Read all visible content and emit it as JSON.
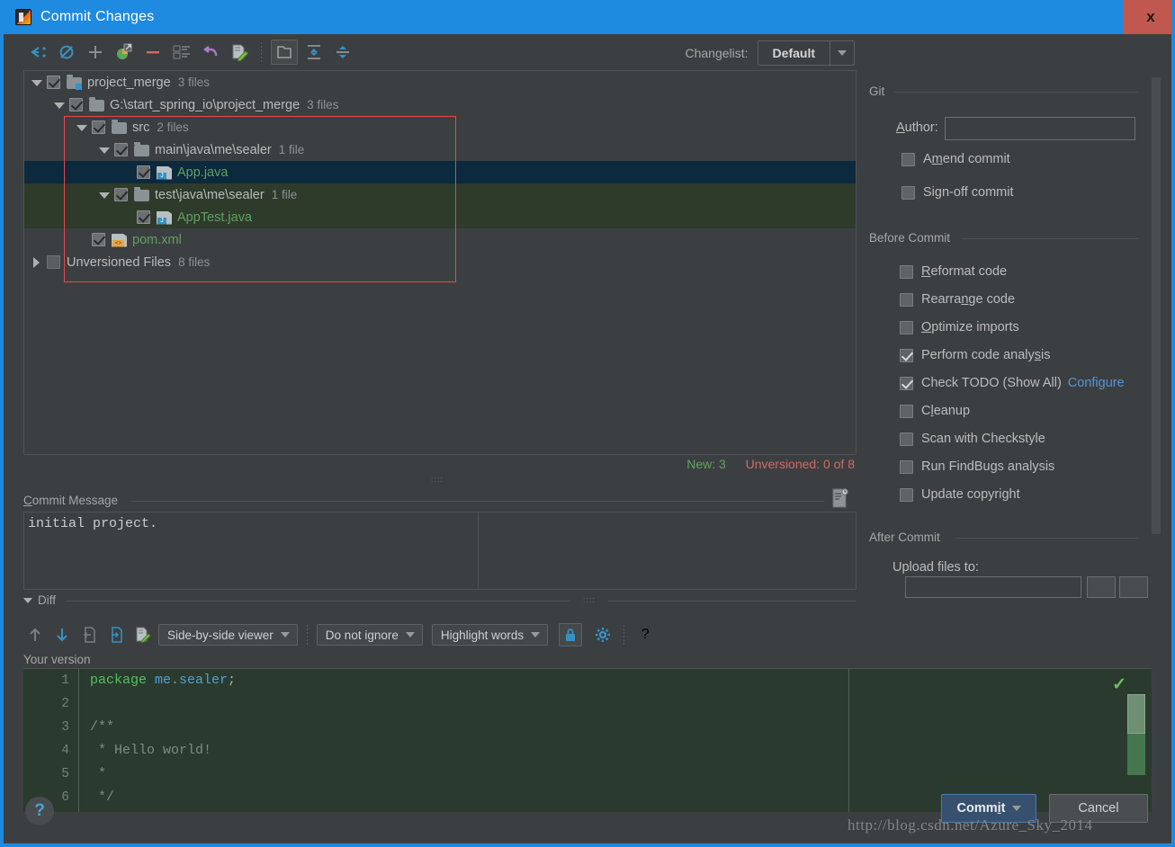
{
  "window": {
    "title": "Commit Changes",
    "app_icon": "intellij-idea-icon",
    "close_label": "x"
  },
  "toolbar": {
    "icons": [
      {
        "name": "show-diff-icon",
        "glyph": "↙"
      },
      {
        "name": "revert-refresh-icon",
        "glyph": "Ø"
      },
      {
        "name": "add-icon",
        "glyph": "+"
      },
      {
        "name": "move-to-changelist-icon",
        "glyph": "❐"
      },
      {
        "name": "delete-icon",
        "glyph": "—"
      },
      {
        "name": "group-by-icon",
        "glyph": "≣"
      },
      {
        "name": "rollback-icon",
        "glyph": "↩"
      },
      {
        "name": "edit-source-icon",
        "glyph": "✎"
      },
      {
        "name": "group-by-directory-icon",
        "glyph": "▣"
      },
      {
        "name": "expand-all-icon",
        "glyph": "⇕"
      },
      {
        "name": "collapse-all-icon",
        "glyph": "⇵"
      }
    ],
    "changelist_label": "Changelist:",
    "changelist_label_mnemonic": "t",
    "changelist_value": "Default"
  },
  "tree": {
    "rows": [
      {
        "indent": 0,
        "twisty": "open",
        "checkbox": "checked",
        "icon": "module-icon",
        "name": "project_merge",
        "count": "3 files",
        "state": "normal",
        "name_class": "nm"
      },
      {
        "indent": 1,
        "twisty": "open",
        "checkbox": "checked",
        "icon": "folder-icon",
        "name": "G:\\start_spring_io\\project_merge",
        "count": "3 files",
        "state": "normal",
        "name_class": "nm"
      },
      {
        "indent": 2,
        "twisty": "open",
        "checkbox": "checked",
        "icon": "folder-icon",
        "name": "src",
        "count": "2 files",
        "state": "normal",
        "name_class": "nm"
      },
      {
        "indent": 3,
        "twisty": "open",
        "checkbox": "checked",
        "icon": "folder-icon",
        "name": "main\\java\\me\\sealer",
        "count": "1 file",
        "state": "normal",
        "name_class": "nm"
      },
      {
        "indent": 4,
        "twisty": "none",
        "checkbox": "checked",
        "icon": "java-file-icon",
        "name": "App.java",
        "count": "",
        "state": "selected",
        "name_class": "nm file-new"
      },
      {
        "indent": 3,
        "twisty": "open",
        "checkbox": "checked",
        "icon": "folder-icon",
        "name": "test\\java\\me\\sealer",
        "count": "1 file",
        "state": "green",
        "name_class": "nm"
      },
      {
        "indent": 4,
        "twisty": "none",
        "checkbox": "checked",
        "icon": "java-file-icon",
        "name": "AppTest.java",
        "count": "",
        "state": "green",
        "name_class": "nm file-new"
      },
      {
        "indent": 2,
        "twisty": "none",
        "checkbox": "checked",
        "icon": "xml-file-icon",
        "name": "pom.xml",
        "count": "",
        "state": "normal",
        "name_class": "nm file-new"
      },
      {
        "indent": 0,
        "twisty": "closed",
        "checkbox": "empty",
        "icon": "none",
        "name": "Unversioned Files",
        "count": "8 files",
        "state": "normal",
        "name_class": "nm"
      }
    ],
    "status_new": "New: 3",
    "status_unversioned": "Unversioned: 0 of 8",
    "annotation": "red-highlight-box"
  },
  "commit_message": {
    "label": "Commit Message",
    "label_mnemonic": "C",
    "value": "initial project.",
    "history_icon": "commit-message-history-icon"
  },
  "diff": {
    "section_label": "Diff",
    "toolbar_icons": [
      {
        "name": "previous-difference-icon",
        "glyph": "↑"
      },
      {
        "name": "next-difference-icon",
        "glyph": "↓"
      },
      {
        "name": "revert-change-icon",
        "glyph": "⇤"
      },
      {
        "name": "apply-change-icon",
        "glyph": "⇥"
      },
      {
        "name": "edit-source-icon",
        "glyph": "✎"
      }
    ],
    "viewer_mode": "Side-by-side viewer",
    "ignore_mode": "Do not ignore",
    "highlight_mode": "Highlight words",
    "lock_icon": "read-only-lock-icon",
    "settings_icon": "gear-icon",
    "help_icon": "question-mark-icon",
    "your_version_label": "Your version",
    "line_numbers": [
      "1",
      "2",
      "3",
      "4",
      "5",
      "6"
    ],
    "code_lines": [
      {
        "segments": [
          {
            "t": "package ",
            "c": "kw"
          },
          {
            "t": "me.sealer",
            "c": "pk"
          },
          {
            "t": ";",
            "c": "pn"
          }
        ]
      },
      {
        "segments": [
          {
            "t": "",
            "c": ""
          }
        ]
      },
      {
        "segments": [
          {
            "t": "/**",
            "c": ""
          }
        ]
      },
      {
        "segments": [
          {
            "t": " * Hello world!",
            "c": ""
          }
        ]
      },
      {
        "segments": [
          {
            "t": " *",
            "c": ""
          }
        ]
      },
      {
        "segments": [
          {
            "t": " */",
            "c": ""
          }
        ]
      }
    ],
    "ok_check_icon": "no-problems-check-icon"
  },
  "git": {
    "section_label": "Git",
    "author_label": "Author:",
    "author_mnemonic": "A",
    "author_value": "",
    "options": [
      {
        "label": "Amend commit",
        "mnemonic": "m",
        "checked": false
      },
      {
        "label": "Sign-off commit",
        "mnemonic": "g",
        "checked": false
      }
    ]
  },
  "before_commit": {
    "section_label": "Before Commit",
    "options": [
      {
        "label": "Reformat code",
        "mnemonic": "R",
        "checked": false,
        "link": ""
      },
      {
        "label": "Rearrange code",
        "mnemonic": "n",
        "checked": false,
        "link": ""
      },
      {
        "label": "Optimize imports",
        "mnemonic": "O",
        "checked": false,
        "link": ""
      },
      {
        "label": "Perform code analysis",
        "mnemonic": "s",
        "checked": true,
        "link": ""
      },
      {
        "label": "Check TODO (Show All)",
        "mnemonic": "",
        "checked": true,
        "link": "Configure"
      },
      {
        "label": "Cleanup",
        "mnemonic": "l",
        "checked": false,
        "link": ""
      },
      {
        "label": "Scan with Checkstyle",
        "mnemonic": "",
        "checked": false,
        "link": ""
      },
      {
        "label": "Run FindBugs analysis",
        "mnemonic": "",
        "checked": false,
        "link": ""
      },
      {
        "label": "Update copyright",
        "mnemonic": "",
        "checked": false,
        "link": ""
      }
    ]
  },
  "after_commit": {
    "section_label": "After Commit",
    "upload_label": "Upload files to:",
    "upload_value": ""
  },
  "footer": {
    "help_label": "?",
    "commit_label": "Comm",
    "commit_label_mnemonic": "i",
    "commit_label_tail": "t",
    "cancel_label": "Cancel",
    "watermark": "http://blog.csdn.net/Azure_Sky_2014"
  },
  "colors": {
    "titlebar": "#1e8ae0",
    "close": "#c0584f",
    "selection": "#0d293e",
    "modified_green": "#2e3b2b",
    "new_file_text": "#60a060",
    "status_new": "#62a362",
    "status_unversioned": "#cf6b63",
    "link": "#5694d6",
    "annotation_red": "#e24b4b"
  }
}
